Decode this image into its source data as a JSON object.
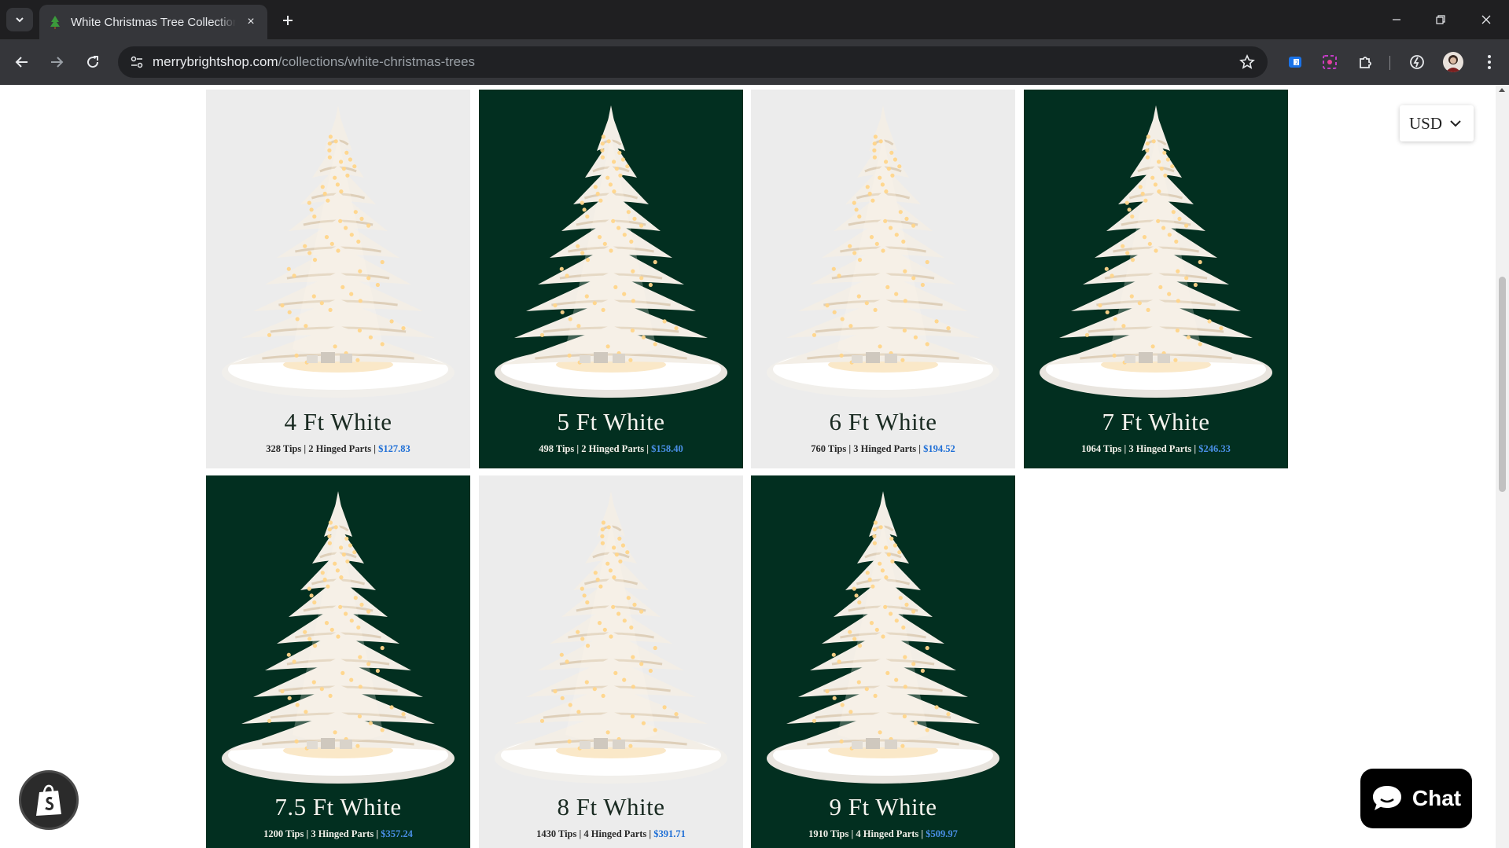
{
  "browser": {
    "tab_title": "White Christmas Tree Collection",
    "tab_close_label": "×",
    "new_tab_label": "+",
    "url_domain": "merrybrightshop.com",
    "url_path": "/collections/white-christmas-trees"
  },
  "page": {
    "currency": "USD",
    "chat_label": "Chat",
    "products": [
      {
        "title": "4 Ft White",
        "tips": "328 Tips",
        "parts": "2 Hinged Parts",
        "price": "$127.83",
        "theme": "light"
      },
      {
        "title": "5 Ft White",
        "tips": "498 Tips",
        "parts": "2 Hinged Parts",
        "price": "$158.40",
        "theme": "dark"
      },
      {
        "title": "6 Ft White",
        "tips": "760 Tips",
        "parts": "3 Hinged Parts",
        "price": "$194.52",
        "theme": "light"
      },
      {
        "title": "7 Ft White",
        "tips": "1064 Tips",
        "parts": "3 Hinged Parts",
        "price": "$246.33",
        "theme": "dark"
      },
      {
        "title": "7.5 Ft White",
        "tips": "1200 Tips",
        "parts": "3 Hinged Parts",
        "price": "$357.24",
        "theme": "dark"
      },
      {
        "title": "8 Ft White",
        "tips": "1430 Tips",
        "parts": "4 Hinged Parts",
        "price": "$391.71",
        "theme": "light"
      },
      {
        "title": "9 Ft White",
        "tips": "1910 Tips",
        "parts": "4 Hinged Parts",
        "price": "$509.97",
        "theme": "dark"
      }
    ]
  },
  "colors": {
    "dark_card": "#022f20",
    "light_card": "#ececec",
    "price_link": "#1f6fd6"
  },
  "icons": [
    "tab-search-icon",
    "tree-favicon",
    "close-icon",
    "plus-icon",
    "minimize-icon",
    "restore-icon",
    "back-icon",
    "forward-icon",
    "reload-icon",
    "site-info-icon",
    "star-icon",
    "extension-icon",
    "puzzle-icon",
    "profile-avatar",
    "menu-icon",
    "shopify-bag-icon",
    "chat-bubble-icon",
    "chevron-down-icon"
  ]
}
